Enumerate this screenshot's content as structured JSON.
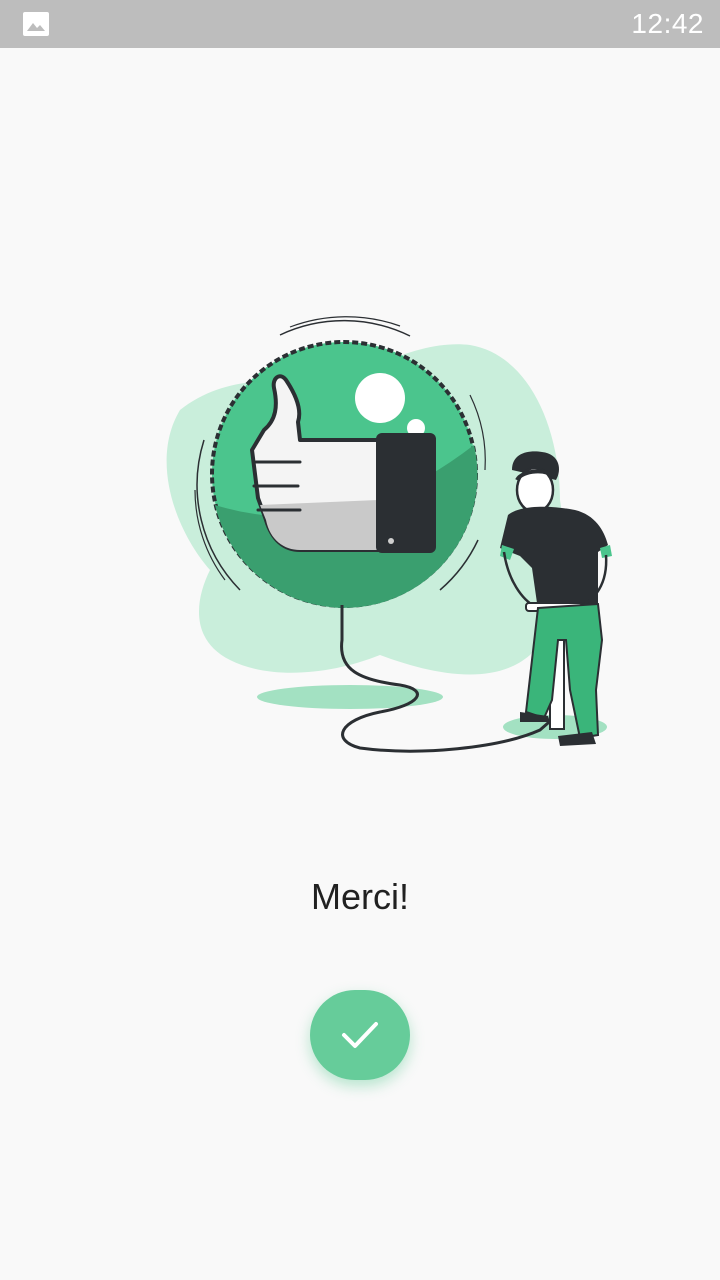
{
  "status_bar": {
    "time": "12:42",
    "image_icon": "image-icon"
  },
  "main": {
    "message": "Merci!",
    "confirm_icon": "check-icon"
  },
  "colors": {
    "accent": "#66cc9a",
    "status_bar": "#bdbdbd",
    "background": "#f9f9f9"
  }
}
